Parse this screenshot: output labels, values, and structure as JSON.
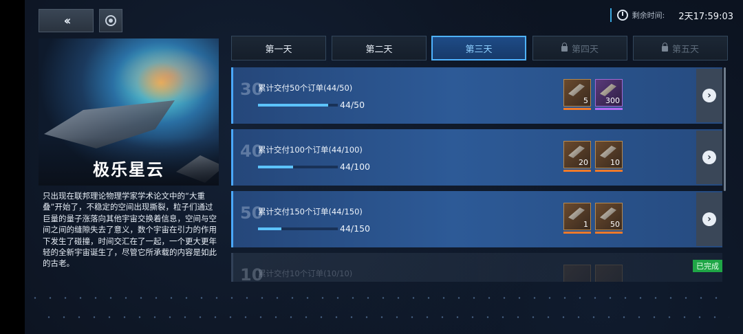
{
  "timer": {
    "label": "剩余时间:",
    "value": "2天17:59:03"
  },
  "nav": {
    "back_icon": "double-chevron-left-icon",
    "home_icon": "ring-icon"
  },
  "stage": {
    "name": "极乐星云",
    "description": "只出现在联邦理论物理学家学术论文中的“大重叠”开始了，不稳定的空间出现撕裂，粒子们通过巨量的量子涨落向其他宇宙交换着信息，空间与空间之间的缝隙失去了意义，数个宇宙在引力的作用下发生了碰撞，时间交汇在了一起，一个更大更年轻的全新宇宙诞生了，尽管它所承载的内容是如此的古老。"
  },
  "tabs": [
    {
      "label": "第一天",
      "state": "normal"
    },
    {
      "label": "第二天",
      "state": "normal"
    },
    {
      "label": "第三天",
      "state": "active"
    },
    {
      "label": "第四天",
      "state": "locked"
    },
    {
      "label": "第五天",
      "state": "locked"
    }
  ],
  "tasks": [
    {
      "req": "30",
      "title": "累计交付50个订单(44/50)",
      "progress_text": "44/50",
      "progress": 0.88,
      "rewards": [
        {
          "icon": "weapon-icon",
          "count": "5",
          "rarity": "orange"
        },
        {
          "icon": "ore-icon",
          "count": "300",
          "rarity": "purple"
        }
      ]
    },
    {
      "req": "40",
      "title": "累计交付100个订单(44/100)",
      "progress_text": "44/100",
      "progress": 0.44,
      "rewards": [
        {
          "icon": "gear-crate-icon",
          "count": "20",
          "rarity": "orange"
        },
        {
          "icon": "blueprint-icon",
          "count": "10",
          "rarity": "orange"
        }
      ]
    },
    {
      "req": "50",
      "title": "累计交付150个订单(44/150)",
      "progress_text": "44/150",
      "progress": 0.29,
      "rewards": [
        {
          "icon": "cannon-icon",
          "count": "1",
          "rarity": "orange"
        },
        {
          "icon": "supply-box-icon",
          "count": "50",
          "rarity": "orange"
        }
      ]
    },
    {
      "req": "10",
      "title": "累计交付10个订单(10/10)",
      "status": "已完成"
    }
  ],
  "colors": {
    "accent": "#4fb3ff",
    "row_bg": "#2d5a97",
    "done": "#1fa646"
  }
}
